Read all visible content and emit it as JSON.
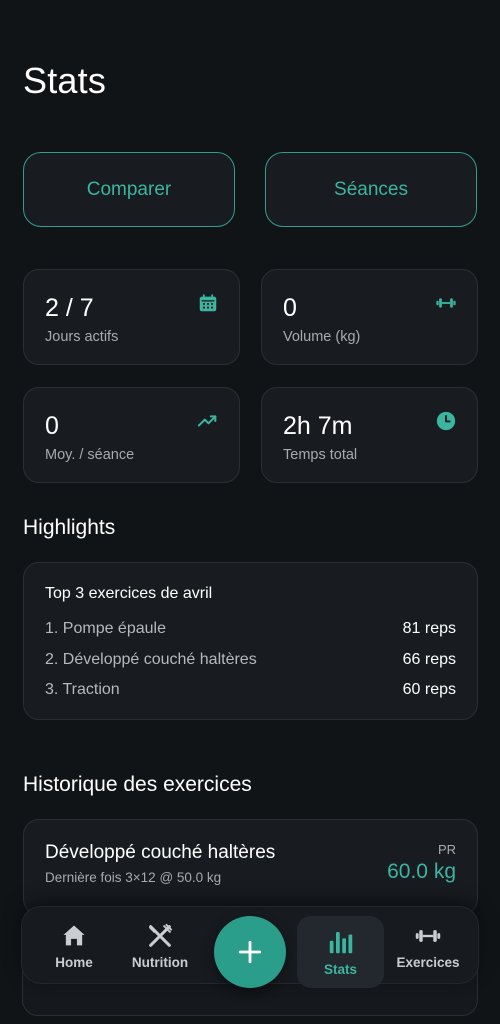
{
  "header": {
    "title": "Stats"
  },
  "actions": {
    "compare_label": "Comparer",
    "sessions_label": "Séances"
  },
  "stats": [
    {
      "value": "2 / 7",
      "label": "Jours actifs",
      "icon": "calendar-icon"
    },
    {
      "value": "0",
      "label": "Volume (kg)",
      "icon": "dumbbell-icon"
    },
    {
      "value": "0",
      "label": "Moy. / séance",
      "icon": "trending-up-icon"
    },
    {
      "value": "2h 7m",
      "label": "Temps total",
      "icon": "clock-icon"
    }
  ],
  "highlights": {
    "section_title": "Highlights",
    "heading": "Top 3 exercices de avril",
    "rows": [
      {
        "name": "1. Pompe épaule",
        "value": "81 reps"
      },
      {
        "name": "2. Développé couché haltères",
        "value": "66 reps"
      },
      {
        "name": "3. Traction",
        "value": "60 reps"
      }
    ]
  },
  "history": {
    "section_title": "Historique des exercices",
    "items": [
      {
        "name": "Développé couché haltères",
        "subtitle": "Dernière fois 3×12 @ 50.0 kg",
        "pr_label": "PR",
        "pr_value": "60.0 kg"
      }
    ]
  },
  "nav": {
    "items": [
      {
        "label": "Home",
        "icon": "home-icon"
      },
      {
        "label": "Nutrition",
        "icon": "utensils-icon"
      },
      {
        "label": "Stats",
        "icon": "bar-chart-icon",
        "active": true
      },
      {
        "label": "Exercices",
        "icon": "dumbbell-icon"
      }
    ],
    "fab_icon": "plus-icon"
  },
  "colors": {
    "background": "#111417",
    "card": "#181c20",
    "accent": "#3bb4a0",
    "fab": "#2a9e8b",
    "muted_text": "#a5abb1"
  }
}
